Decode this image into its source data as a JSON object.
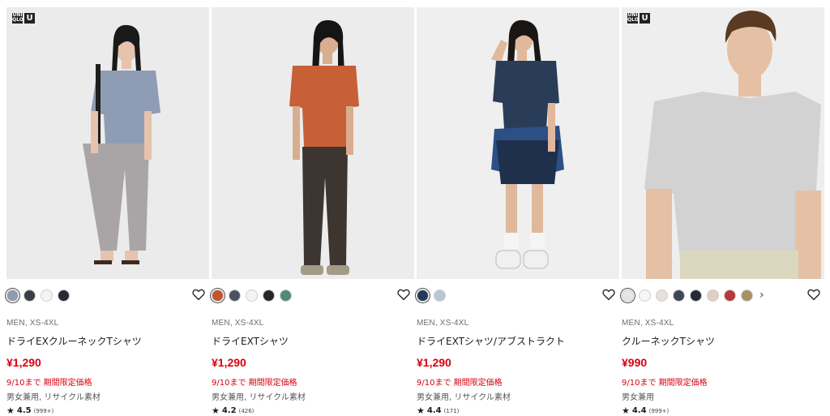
{
  "logo": {
    "top": "UNI QLO",
    "u": "U"
  },
  "products": [
    {
      "show_logo": true,
      "swatches": [
        "#8e9bb0",
        "#3a3f47",
        "#f4f4f4",
        "#262b33"
      ],
      "selected": 0,
      "has_more": false,
      "gender_size": "MEN, XS-4XL",
      "name": "ドライEXクルーネックTシャツ",
      "price": "¥1,290",
      "promo": "9/10まで 期間限定価格",
      "features": "男女兼用, リサイクル素材",
      "rating": "4.5",
      "review_count": "(999+)",
      "photo": {
        "bg": "#ebebeb",
        "top": "#8f9db4",
        "bottom": "#a9a4a6",
        "skin": "#e6c3ac",
        "hair": "#1a1a1a"
      }
    },
    {
      "show_logo": false,
      "swatches": [
        "#c4552c",
        "#4c5260",
        "#f4f4f4",
        "#262626",
        "#4f8a7c"
      ],
      "selected": 0,
      "has_more": false,
      "gender_size": "MEN, XS-4XL",
      "name": "ドライEXTシャツ",
      "price": "¥1,290",
      "promo": "9/10まで 期間限定価格",
      "features": "男女兼用, リサイクル素材",
      "rating": "4.2",
      "review_count": "(426)",
      "photo": {
        "bg": "#ececec",
        "top": "#c75f37",
        "bottom": "#3d3530",
        "skin": "#d9ad90",
        "hair": "#151515"
      }
    },
    {
      "show_logo": false,
      "swatches": [
        "#243a5c",
        "#b9c7d6"
      ],
      "selected": 0,
      "has_more": false,
      "gender_size": "MEN, XS-4XL",
      "name": "ドライEXTシャツ/アブストラクト",
      "price": "¥1,290",
      "promo": "9/10まで 期間限定価格",
      "features": "男女兼用, リサイクル素材",
      "rating": "4.4",
      "review_count": "(171)",
      "photo": {
        "bg": "#efefef",
        "top": "#2a3d58",
        "bottom": "#2c4f86",
        "skin": "#e0b89c",
        "hair": "#1a1614"
      }
    },
    {
      "show_logo": true,
      "swatches": [
        "#e6e6e6",
        "#f6f6f6",
        "#e6e1dc",
        "#3f4658",
        "#262a36",
        "#e2cfbf",
        "#b53a38",
        "#a89064"
      ],
      "selected": 0,
      "has_more": true,
      "gender_size": "MEN, XS-4XL",
      "name": "クルーネックTシャツ",
      "price": "¥990",
      "promo": "9/10まで 期間限定価格",
      "features": "男女兼用",
      "rating": "4.4",
      "review_count": "(999+)",
      "photo": {
        "bg": "#eeeeee",
        "top": "#d2d2d2",
        "bottom": "#dcd8c0",
        "skin": "#e6c0a4",
        "hair": "#5a3a22"
      }
    }
  ]
}
